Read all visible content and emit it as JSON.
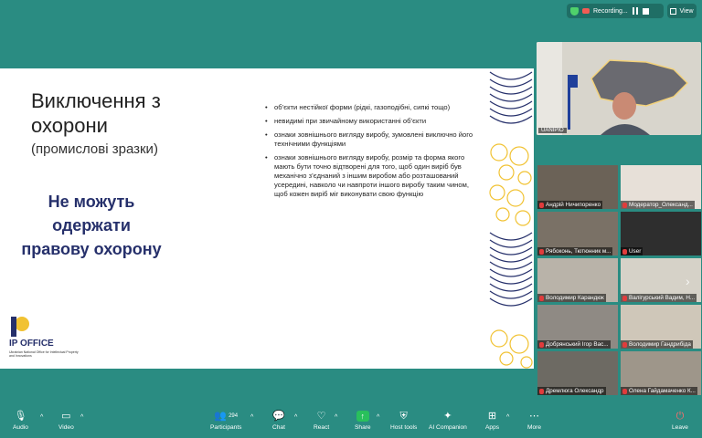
{
  "topbar": {
    "recording_label": "Recording...",
    "view_label": "View"
  },
  "slide": {
    "title": "Виключення з охорони",
    "subtitle": "(промислові зразки)",
    "highlight": "Не можуть одержати правову охорону",
    "bullets": [
      "об’єкти нестійкої форми (рідкі, газоподібні, сипкі тощо)",
      "невидимі при звичайному використанні об’єкти",
      "ознаки зовнішнього вигляду виробу, зумовлені виключно його технічними функціями",
      "ознаки зовнішнього вигляду виробу, розмір та форма якого мають бути точно відтворені для того, щоб один виріб був механічно з’єднаний з іншим виробом або розташований усередині, навколо чи навпроти іншого виробу таким чином, щоб кожен виріб міг виконувати свою функцію"
    ],
    "logo_text": "IP OFFICE",
    "logo_small": "Ukrainian National Office for Intellectual Property and Innovations",
    "colors": {
      "title_blue": "#26306b",
      "logo_yellow": "#f1c232"
    }
  },
  "speaker": {
    "name": "UANIPIO"
  },
  "participants": [
    {
      "name": "Андрій Ничипоренко",
      "muted": true
    },
    {
      "name": "Модератор_Олександ...",
      "muted": true
    },
    {
      "name": "Рябоконь, Тютюнник м...",
      "muted": true
    },
    {
      "name": "User",
      "muted": true
    },
    {
      "name": "Володимир Карандюк",
      "muted": true
    },
    {
      "name": "Валігурський Вадим, Н...",
      "muted": true
    },
    {
      "name": "Добрянський Ігор Вас...",
      "muted": true
    },
    {
      "name": "Володимир Гандрибіда",
      "muted": true
    },
    {
      "name": "Дремлюга Олександр",
      "muted": true
    },
    {
      "name": "Олена Гайдамаченко К...",
      "muted": true
    }
  ],
  "toolbar": {
    "audio": "Audio",
    "video": "Video",
    "participants": "Participants",
    "participants_count": "294",
    "chat": "Chat",
    "react": "React",
    "share": "Share",
    "host_tools": "Host tools",
    "ai_companion": "AI Companion",
    "apps": "Apps",
    "more": "More",
    "leave": "Leave"
  },
  "colors": {
    "window_bg": "#2a8c82",
    "share_green": "#29c05c",
    "muted_red": "#e03c3c"
  }
}
